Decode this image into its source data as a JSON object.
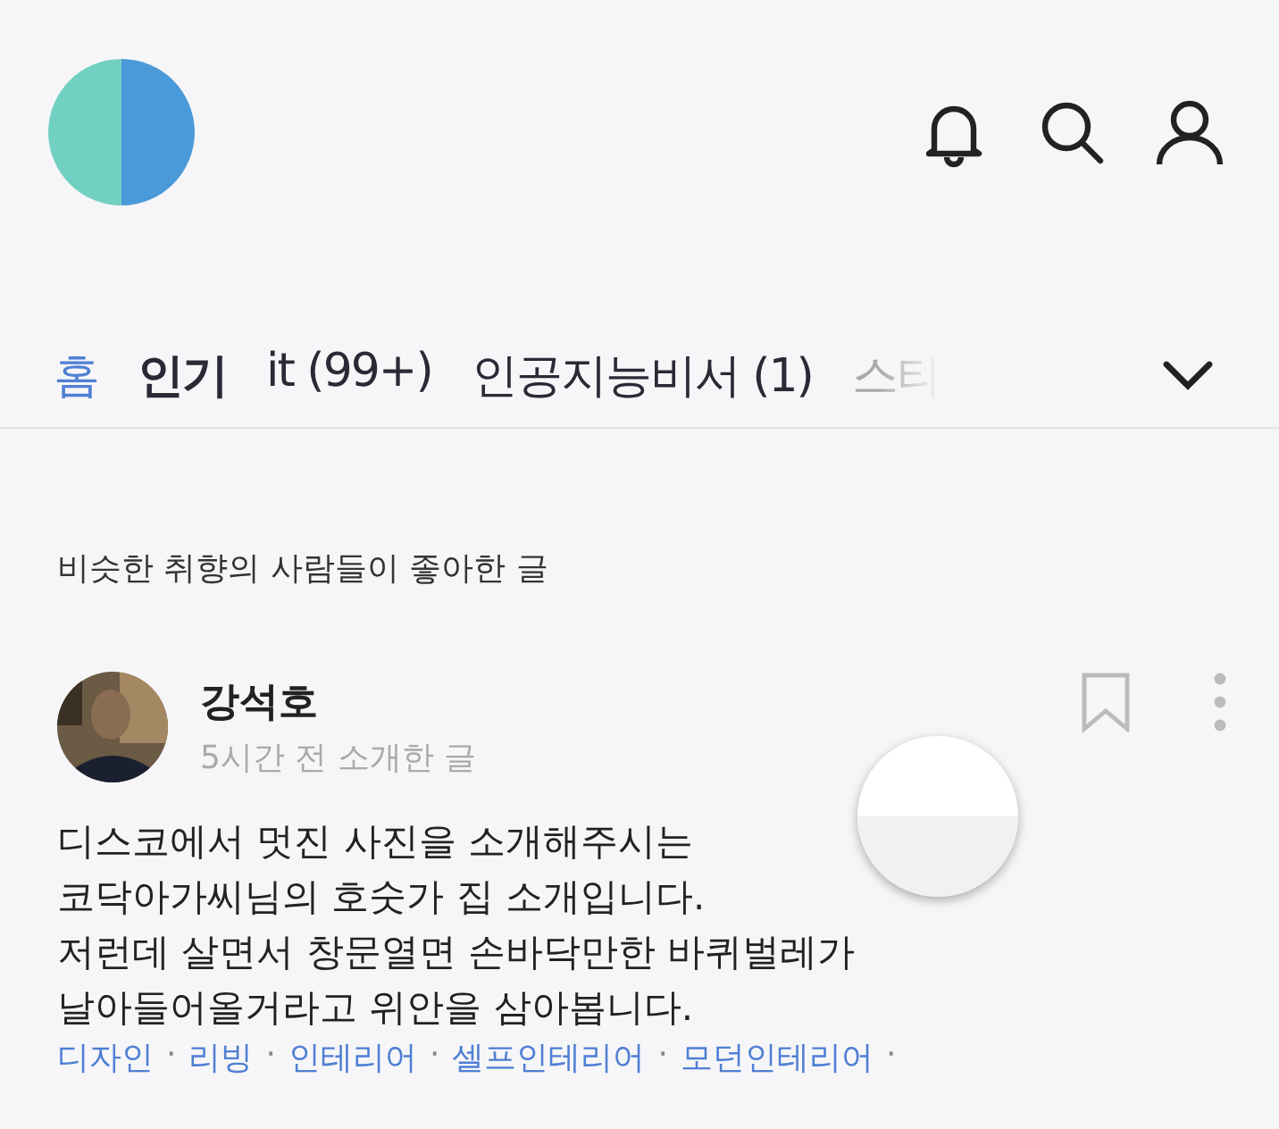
{
  "tabs": [
    {
      "label": "홈",
      "selected": true,
      "emphasized": false,
      "faded": false
    },
    {
      "label": "인기",
      "selected": false,
      "emphasized": true,
      "faded": false
    },
    {
      "label": "it (99+)",
      "selected": false,
      "emphasized": false,
      "faded": false
    },
    {
      "label": "인공지능비서 (1)",
      "selected": false,
      "emphasized": false,
      "faded": false
    },
    {
      "label": "스타",
      "selected": false,
      "emphasized": false,
      "faded": true
    }
  ],
  "section_title": "비슷한 취향의 사람들이 좋아한 글",
  "post": {
    "author": "강석호",
    "meta": "5시간 전 소개한 글",
    "body": [
      "디스코에서 멋진 사진을 소개해주시는",
      "코닥아가씨님의 호숫가 집 소개입니다.",
      "저런데 살면서 창문열면 손바닥만한 바퀴벌레가",
      "날아들어올거라고 위안을 삼아봅니다."
    ],
    "tag_separator": "·",
    "tags": [
      "디자인",
      "리빙",
      "인테리어",
      "셀프인테리어",
      "모던인테리어"
    ]
  }
}
